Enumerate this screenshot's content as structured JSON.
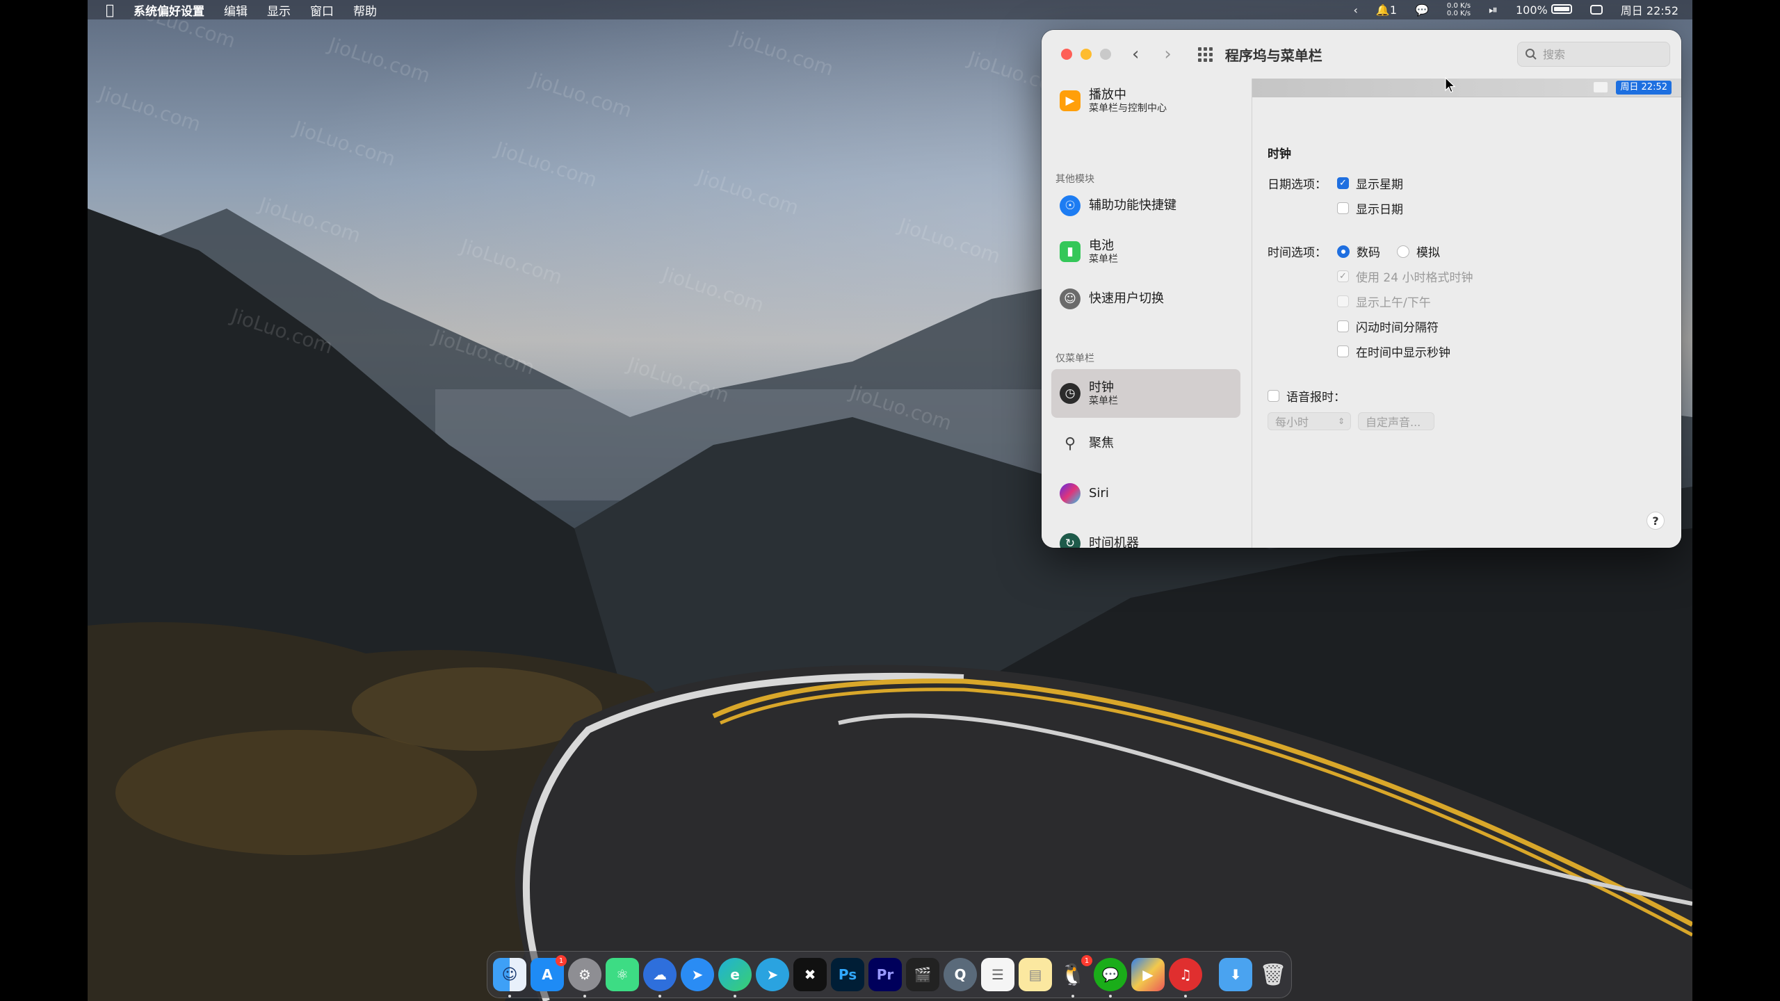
{
  "menubar": {
    "app_name": "系统偏好设置",
    "menus": [
      "编辑",
      "显示",
      "窗口",
      "帮助"
    ],
    "notifications": "1",
    "net_up": "0.0 K/s",
    "net_down": "0.0 K/s",
    "battery": "100%",
    "clock": "周日 22:52"
  },
  "window": {
    "title": "程序坞与菜单栏",
    "search_placeholder": "搜索"
  },
  "sidebar": {
    "top_item": {
      "label": "播放中",
      "sub": "菜单栏与控制中心"
    },
    "section_other": "其他模块",
    "other_items": [
      {
        "label": "辅助功能快捷键",
        "sub": ""
      },
      {
        "label": "电池",
        "sub": "菜单栏"
      },
      {
        "label": "快速用户切换",
        "sub": ""
      }
    ],
    "section_menubar_only": "仅菜单栏",
    "menubar_items": [
      {
        "label": "时钟",
        "sub": "菜单栏",
        "selected": true
      },
      {
        "label": "聚焦",
        "sub": ""
      },
      {
        "label": "Siri",
        "sub": ""
      },
      {
        "label": "时间机器",
        "sub": ""
      }
    ]
  },
  "content": {
    "preview_clock": "周日 22:52",
    "section_title": "时钟",
    "date_options_label": "日期选项：",
    "show_weekday": {
      "label": "显示星期",
      "checked": true
    },
    "show_date": {
      "label": "显示日期",
      "checked": false
    },
    "time_options_label": "时间选项：",
    "digital": {
      "label": "数码",
      "selected": true
    },
    "analog": {
      "label": "模拟",
      "selected": false
    },
    "use_24h": {
      "label": "使用 24 小时格式时钟",
      "checked": true,
      "enabled": false
    },
    "show_ampm": {
      "label": "显示上午/下午",
      "checked": false,
      "enabled": false
    },
    "flash_separators": {
      "label": "闪动时间分隔符",
      "checked": false
    },
    "show_seconds": {
      "label": "在时间中显示秒钟",
      "checked": false
    },
    "announce_time": {
      "label": "语音报时：",
      "checked": false
    },
    "interval_select": "每小时",
    "custom_voice_button": "自定声音...",
    "help_button": "?"
  },
  "dock": {
    "app_store_badge": "1",
    "qq_badge": "1",
    "photoshop_label": "Ps",
    "premiere_label": "Pr"
  },
  "watermark": "JioLuo.com",
  "colors": {
    "accent": "#1f6fe0",
    "window_bg": "#ececec",
    "selected_row": "#d3cfcf"
  }
}
